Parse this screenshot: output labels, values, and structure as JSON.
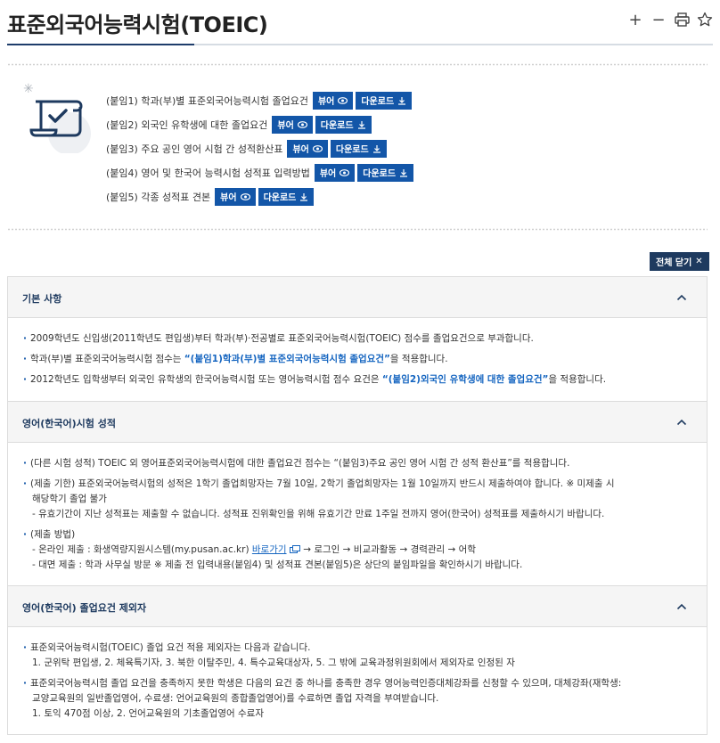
{
  "page": {
    "title": "표준외국어능력시험(TOEIC)"
  },
  "toolbar": {
    "plus": "+",
    "minus": "−"
  },
  "attachments": [
    {
      "label": "(붙임1) 학과(부)별 표준외국어능력시험 졸업요건",
      "view": "뷰어",
      "download": "다운로드"
    },
    {
      "label": "(붙임2) 외국인 유학생에 대한 졸업요건",
      "view": "뷰어",
      "download": "다운로드"
    },
    {
      "label": "(붙임3) 주요 공인 영어 시험 간 성적환산표",
      "view": "뷰어",
      "download": "다운로드"
    },
    {
      "label": "(붙임4) 영어 및 한국어 능력시험 성적표 입력방법",
      "view": "뷰어",
      "download": "다운로드"
    },
    {
      "label": "(붙임5) 각종 성적표 견본",
      "view": "뷰어",
      "download": "다운로드"
    }
  ],
  "close_all": {
    "label": "전체 닫기",
    "icon": "✕"
  },
  "sections": {
    "basic": {
      "title": "기본 사항",
      "b1": "2009학년도 신입생(2011학년도 편입생)부터 학과(부)·전공별로 표준외국어능력시험(TOEIC) 점수를 졸업요건으로 부과합니다.",
      "b2_pre": "학과(부)별 표준외국어능력시험 점수는 ",
      "b2_hl": "“(붙임1)학과(부)별 표준외국어능력시험 졸업요건”",
      "b2_post": "을 적용합니다.",
      "b3_pre": "2012학년도 입학생부터 외국인 유학생의 한국어능력시험 또는 영어능력시험 점수 요건은 ",
      "b3_hl": "“(붙임2)외국인 유학생에 대한 졸업요건”",
      "b3_post": "을 적용합니다."
    },
    "score": {
      "title": "영어(한국어)시험 성적",
      "b1": "(다른 시험 성적) TOEIC 외 영어표준외국어능력시험에 대한 졸업요건 점수는 “(붙임3)주요 공인 영어 시험 간 성적 환산표”를 적용합니다.",
      "b2_l1": "(제출 기한)  표준외국어능력시험의 성적은 1학기 졸업희망자는 7월 10일, 2학기 졸업희망자는 1월 10일까지 반드시 제출하여야 합니다. ※ 미제출 시",
      "b2_l2": "해당학기 졸업 불가",
      "b2_sub": "- 유효기간이 지난 성적표는 제출할 수 없습니다. 성적표 진위확인을 위해 유효기간 만료 1주일 전까지 영어(한국어) 성적표를 제출하시기 바랍니다.",
      "b3": "(제출 방법)",
      "b3_sub1_pre": "- 온라인 제출 : 화생역량지원시스템(my.pusan.ac.kr) ",
      "b3_sub1_link": "바로가기",
      "b3_sub1_post": " → 로그인 → 비교과활동 → 경력관리 → 어학",
      "b3_sub2": "- 대면 제출 : 학과 사무실 방문 ※ 제출 전 입력내용(붙임4) 및 성적표 견본(붙임5)은 상단의 붙임파일을 확인하시기 바랍니다."
    },
    "exempt": {
      "title": "영어(한국어) 졸업요건 제외자",
      "b1": "표준외국어능력시험(TOEIC) 졸업 요건 적용 제외자는 다음과 같습니다.",
      "b1_sub": "1. 군위탁 편입생, 2. 체육특기자, 3. 북한 이탈주민, 4. 특수교육대상자, 5. 그 밖에 교육과정위원회에서 제외자로 인정된 자",
      "b2_l1": "표준외국어능력시험 졸업 요건을 충족하지 못한 학생은 다음의 요건 중 하나를 충족한 경우 영어능력인증대체강좌를 신청할 수 있으며, 대체강좌(재학생:",
      "b2_l2": "교양교육원의 일반졸업영어, 수료생: 언어교육원의 종합졸업영어)를 수료하면 졸업 자격을 부여받습니다.",
      "b2_sub": "1. 토익 470점 이상, 2. 언어교육원의 기초졸업영어 수료자"
    }
  }
}
